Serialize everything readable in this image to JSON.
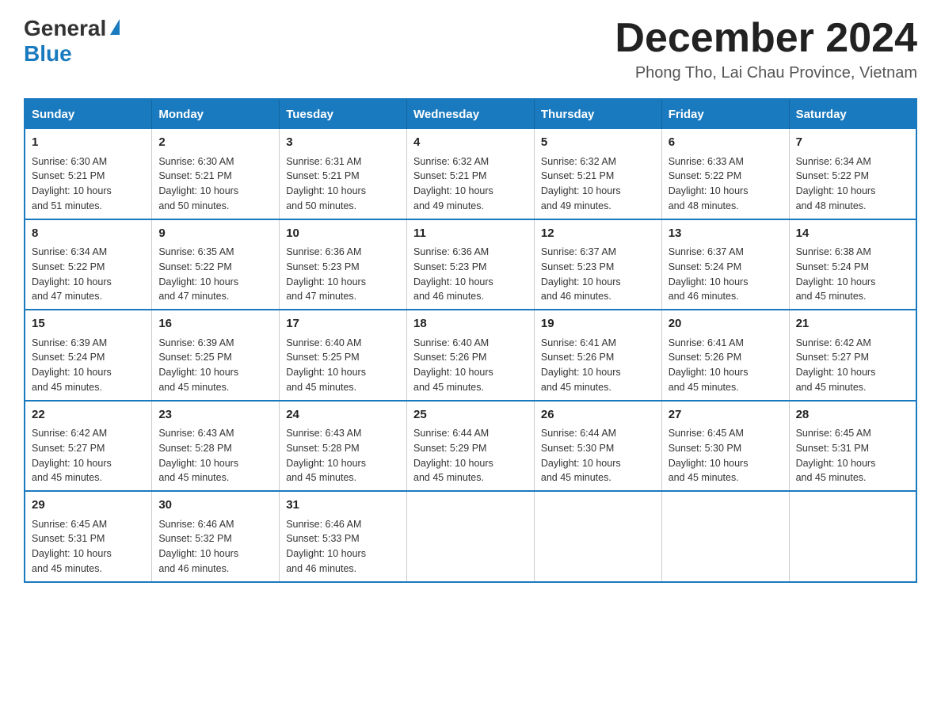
{
  "header": {
    "logo_general": "General",
    "logo_blue": "Blue",
    "month_title": "December 2024",
    "location": "Phong Tho, Lai Chau Province, Vietnam"
  },
  "weekdays": [
    "Sunday",
    "Monday",
    "Tuesday",
    "Wednesday",
    "Thursday",
    "Friday",
    "Saturday"
  ],
  "weeks": [
    [
      {
        "day": "1",
        "sunrise": "6:30 AM",
        "sunset": "5:21 PM",
        "daylight": "10 hours and 51 minutes."
      },
      {
        "day": "2",
        "sunrise": "6:30 AM",
        "sunset": "5:21 PM",
        "daylight": "10 hours and 50 minutes."
      },
      {
        "day": "3",
        "sunrise": "6:31 AM",
        "sunset": "5:21 PM",
        "daylight": "10 hours and 50 minutes."
      },
      {
        "day": "4",
        "sunrise": "6:32 AM",
        "sunset": "5:21 PM",
        "daylight": "10 hours and 49 minutes."
      },
      {
        "day": "5",
        "sunrise": "6:32 AM",
        "sunset": "5:21 PM",
        "daylight": "10 hours and 49 minutes."
      },
      {
        "day": "6",
        "sunrise": "6:33 AM",
        "sunset": "5:22 PM",
        "daylight": "10 hours and 48 minutes."
      },
      {
        "day": "7",
        "sunrise": "6:34 AM",
        "sunset": "5:22 PM",
        "daylight": "10 hours and 48 minutes."
      }
    ],
    [
      {
        "day": "8",
        "sunrise": "6:34 AM",
        "sunset": "5:22 PM",
        "daylight": "10 hours and 47 minutes."
      },
      {
        "day": "9",
        "sunrise": "6:35 AM",
        "sunset": "5:22 PM",
        "daylight": "10 hours and 47 minutes."
      },
      {
        "day": "10",
        "sunrise": "6:36 AM",
        "sunset": "5:23 PM",
        "daylight": "10 hours and 47 minutes."
      },
      {
        "day": "11",
        "sunrise": "6:36 AM",
        "sunset": "5:23 PM",
        "daylight": "10 hours and 46 minutes."
      },
      {
        "day": "12",
        "sunrise": "6:37 AM",
        "sunset": "5:23 PM",
        "daylight": "10 hours and 46 minutes."
      },
      {
        "day": "13",
        "sunrise": "6:37 AM",
        "sunset": "5:24 PM",
        "daylight": "10 hours and 46 minutes."
      },
      {
        "day": "14",
        "sunrise": "6:38 AM",
        "sunset": "5:24 PM",
        "daylight": "10 hours and 45 minutes."
      }
    ],
    [
      {
        "day": "15",
        "sunrise": "6:39 AM",
        "sunset": "5:24 PM",
        "daylight": "10 hours and 45 minutes."
      },
      {
        "day": "16",
        "sunrise": "6:39 AM",
        "sunset": "5:25 PM",
        "daylight": "10 hours and 45 minutes."
      },
      {
        "day": "17",
        "sunrise": "6:40 AM",
        "sunset": "5:25 PM",
        "daylight": "10 hours and 45 minutes."
      },
      {
        "day": "18",
        "sunrise": "6:40 AM",
        "sunset": "5:26 PM",
        "daylight": "10 hours and 45 minutes."
      },
      {
        "day": "19",
        "sunrise": "6:41 AM",
        "sunset": "5:26 PM",
        "daylight": "10 hours and 45 minutes."
      },
      {
        "day": "20",
        "sunrise": "6:41 AM",
        "sunset": "5:26 PM",
        "daylight": "10 hours and 45 minutes."
      },
      {
        "day": "21",
        "sunrise": "6:42 AM",
        "sunset": "5:27 PM",
        "daylight": "10 hours and 45 minutes."
      }
    ],
    [
      {
        "day": "22",
        "sunrise": "6:42 AM",
        "sunset": "5:27 PM",
        "daylight": "10 hours and 45 minutes."
      },
      {
        "day": "23",
        "sunrise": "6:43 AM",
        "sunset": "5:28 PM",
        "daylight": "10 hours and 45 minutes."
      },
      {
        "day": "24",
        "sunrise": "6:43 AM",
        "sunset": "5:28 PM",
        "daylight": "10 hours and 45 minutes."
      },
      {
        "day": "25",
        "sunrise": "6:44 AM",
        "sunset": "5:29 PM",
        "daylight": "10 hours and 45 minutes."
      },
      {
        "day": "26",
        "sunrise": "6:44 AM",
        "sunset": "5:30 PM",
        "daylight": "10 hours and 45 minutes."
      },
      {
        "day": "27",
        "sunrise": "6:45 AM",
        "sunset": "5:30 PM",
        "daylight": "10 hours and 45 minutes."
      },
      {
        "day": "28",
        "sunrise": "6:45 AM",
        "sunset": "5:31 PM",
        "daylight": "10 hours and 45 minutes."
      }
    ],
    [
      {
        "day": "29",
        "sunrise": "6:45 AM",
        "sunset": "5:31 PM",
        "daylight": "10 hours and 45 minutes."
      },
      {
        "day": "30",
        "sunrise": "6:46 AM",
        "sunset": "5:32 PM",
        "daylight": "10 hours and 46 minutes."
      },
      {
        "day": "31",
        "sunrise": "6:46 AM",
        "sunset": "5:33 PM",
        "daylight": "10 hours and 46 minutes."
      },
      null,
      null,
      null,
      null
    ]
  ],
  "labels": {
    "sunrise": "Sunrise:",
    "sunset": "Sunset:",
    "daylight": "Daylight:"
  }
}
